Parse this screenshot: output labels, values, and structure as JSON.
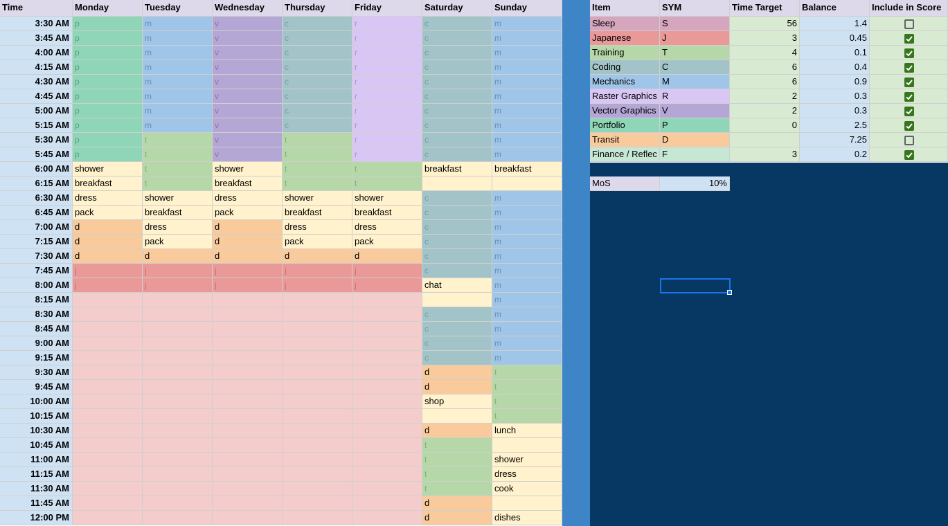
{
  "headers": [
    "Time",
    "Monday",
    "Tuesday",
    "Wednesday",
    "Thursday",
    "Friday",
    "Saturday",
    "Sunday"
  ],
  "colors": {
    "p": "#8fd6b8",
    "m": "#9fc5e8",
    "v": "#b4a7d6",
    "c": "#a2c4c9",
    "r": "#d9c6f5",
    "t": "#b6d7a8",
    "d": "#f9cb9c",
    "j": "#ea9999",
    "pink": "#f4cccc",
    "y": "#fff2cc",
    "time_col": "#cfe2f3",
    "header": "#ddd8ea"
  },
  "times": [
    "3:30 AM",
    "3:45 AM",
    "4:00 AM",
    "4:15 AM",
    "4:30 AM",
    "4:45 AM",
    "5:00 AM",
    "5:15 AM",
    "5:30 AM",
    "5:45 AM",
    "6:00 AM",
    "6:15 AM",
    "6:30 AM",
    "6:45 AM",
    "7:00 AM",
    "7:15 AM",
    "7:30 AM",
    "7:45 AM",
    "8:00 AM",
    "8:15 AM",
    "8:30 AM",
    "8:45 AM",
    "9:00 AM",
    "9:15 AM",
    "9:30 AM",
    "9:45 AM",
    "10:00 AM",
    "10:15 AM",
    "10:30 AM",
    "10:45 AM",
    "11:00 AM",
    "11:15 AM",
    "11:30 AM",
    "11:45 AM",
    "12:00 PM"
  ],
  "schedule": {
    "Monday": [
      "p",
      "p",
      "p",
      "p",
      "p",
      "p",
      "p",
      "p",
      "p",
      "p",
      "shower",
      "breakfast",
      "dress",
      "pack",
      "d",
      "d",
      "d",
      "j",
      "j",
      "",
      "",
      "",
      "",
      "",
      "",
      "",
      "",
      "",
      "",
      "",
      "",
      "",
      "",
      "",
      ""
    ],
    "Tuesday": [
      "m",
      "m",
      "m",
      "m",
      "m",
      "m",
      "m",
      "m",
      "t",
      "t",
      "t",
      "t",
      "shower",
      "breakfast",
      "dress",
      "pack",
      "d",
      "j",
      "j",
      "",
      "",
      "",
      "",
      "",
      "",
      "",
      "",
      "",
      "",
      "",
      "",
      "",
      "",
      "",
      ""
    ],
    "Wednesday": [
      "v",
      "v",
      "v",
      "v",
      "v",
      "v",
      "v",
      "v",
      "v",
      "v",
      "shower",
      "breakfast",
      "dress",
      "pack",
      "d",
      "d",
      "d",
      "j",
      "j",
      "",
      "",
      "",
      "",
      "",
      "",
      "",
      "",
      "",
      "",
      "",
      "",
      "",
      "",
      "",
      ""
    ],
    "Thursday": [
      "c",
      "c",
      "c",
      "c",
      "c",
      "c",
      "c",
      "c",
      "t",
      "t",
      "t",
      "t",
      "shower",
      "breakfast",
      "dress",
      "pack",
      "d",
      "j",
      "j",
      "",
      "",
      "",
      "",
      "",
      "",
      "",
      "",
      "",
      "",
      "",
      "",
      "",
      "",
      "",
      ""
    ],
    "Friday": [
      "r",
      "r",
      "r",
      "r",
      "r",
      "r",
      "r",
      "r",
      "r",
      "r",
      "t",
      "t",
      "shower",
      "breakfast",
      "dress",
      "pack",
      "d",
      "j",
      "j",
      "",
      "",
      "",
      "",
      "",
      "",
      "",
      "",
      "",
      "",
      "",
      "",
      "",
      "",
      "",
      ""
    ],
    "Saturday": [
      "c",
      "c",
      "c",
      "c",
      "c",
      "c",
      "c",
      "c",
      "c",
      "c",
      "breakfast",
      "",
      "c",
      "c",
      "c",
      "c",
      "c",
      "c",
      "chat",
      "",
      "c",
      "c",
      "c",
      "c",
      "d",
      "d",
      "shop",
      "",
      "d",
      "t",
      "t",
      "t",
      "t",
      "d",
      "d"
    ],
    "Sunday": [
      "m",
      "m",
      "m",
      "m",
      "m",
      "m",
      "m",
      "m",
      "m",
      "m",
      "breakfast",
      "",
      "m",
      "m",
      "m",
      "m",
      "m",
      "m",
      "m",
      "m",
      "m",
      "m",
      "m",
      "m",
      "t",
      "t",
      "t",
      "t",
      "lunch",
      "",
      "shower",
      "dress",
      "cook",
      "",
      "dishes"
    ]
  },
  "fills": {
    "Monday": [
      "p",
      "p",
      "p",
      "p",
      "p",
      "p",
      "p",
      "p",
      "p",
      "p",
      "y",
      "y",
      "y",
      "y",
      "d",
      "d",
      "d",
      "j",
      "j",
      "pink",
      "pink",
      "pink",
      "pink",
      "pink",
      "pink",
      "pink",
      "pink",
      "pink",
      "pink",
      "pink",
      "pink",
      "pink",
      "pink",
      "pink",
      "pink"
    ],
    "Tuesday": [
      "m",
      "m",
      "m",
      "m",
      "m",
      "m",
      "m",
      "m",
      "t",
      "t",
      "t",
      "t",
      "y",
      "y",
      "y",
      "y",
      "d",
      "j",
      "j",
      "pink",
      "pink",
      "pink",
      "pink",
      "pink",
      "pink",
      "pink",
      "pink",
      "pink",
      "pink",
      "pink",
      "pink",
      "pink",
      "pink",
      "pink",
      "pink"
    ],
    "Wednesday": [
      "v",
      "v",
      "v",
      "v",
      "v",
      "v",
      "v",
      "v",
      "v",
      "v",
      "y",
      "y",
      "y",
      "y",
      "d",
      "d",
      "d",
      "j",
      "j",
      "pink",
      "pink",
      "pink",
      "pink",
      "pink",
      "pink",
      "pink",
      "pink",
      "pink",
      "pink",
      "pink",
      "pink",
      "pink",
      "pink",
      "pink",
      "pink"
    ],
    "Thursday": [
      "c",
      "c",
      "c",
      "c",
      "c",
      "c",
      "c",
      "c",
      "t",
      "t",
      "t",
      "t",
      "y",
      "y",
      "y",
      "y",
      "d",
      "j",
      "j",
      "pink",
      "pink",
      "pink",
      "pink",
      "pink",
      "pink",
      "pink",
      "pink",
      "pink",
      "pink",
      "pink",
      "pink",
      "pink",
      "pink",
      "pink",
      "pink"
    ],
    "Friday": [
      "r",
      "r",
      "r",
      "r",
      "r",
      "r",
      "r",
      "r",
      "r",
      "r",
      "t",
      "t",
      "y",
      "y",
      "y",
      "y",
      "d",
      "j",
      "j",
      "pink",
      "pink",
      "pink",
      "pink",
      "pink",
      "pink",
      "pink",
      "pink",
      "pink",
      "pink",
      "pink",
      "pink",
      "pink",
      "pink",
      "pink",
      "pink"
    ],
    "Saturday": [
      "c",
      "c",
      "c",
      "c",
      "c",
      "c",
      "c",
      "c",
      "c",
      "c",
      "y",
      "y",
      "c",
      "c",
      "c",
      "c",
      "c",
      "c",
      "y",
      "y",
      "c",
      "c",
      "c",
      "c",
      "d",
      "d",
      "y",
      "y",
      "d",
      "t",
      "t",
      "t",
      "t",
      "d",
      "d"
    ],
    "Sunday": [
      "m",
      "m",
      "m",
      "m",
      "m",
      "m",
      "m",
      "m",
      "m",
      "m",
      "y",
      "y",
      "m",
      "m",
      "m",
      "m",
      "m",
      "m",
      "m",
      "m",
      "m",
      "m",
      "m",
      "m",
      "t",
      "t",
      "t",
      "t",
      "y",
      "y",
      "y",
      "y",
      "y",
      "y",
      "y"
    ]
  },
  "summary": {
    "headers": [
      "Item",
      "SYM",
      "Time Target",
      "Balance",
      "Include in Score"
    ],
    "rows": [
      {
        "item": "Sleep",
        "sym": "S",
        "target": "56",
        "balance": "1.4",
        "include": false,
        "color": "#d5a6bd"
      },
      {
        "item": "Japanese",
        "sym": "J",
        "target": "3",
        "balance": "0.45",
        "include": true,
        "color": "#ea9999"
      },
      {
        "item": "Training",
        "sym": "T",
        "target": "4",
        "balance": "0.1",
        "include": true,
        "color": "#b6d7a8"
      },
      {
        "item": "Coding",
        "sym": "C",
        "target": "6",
        "balance": "0.4",
        "include": true,
        "color": "#a2c4c9"
      },
      {
        "item": "Mechanics",
        "sym": "M",
        "target": "6",
        "balance": "0.9",
        "include": true,
        "color": "#9fc5e8"
      },
      {
        "item": "Raster Graphics",
        "sym": "R",
        "target": "2",
        "balance": "0.3",
        "include": true,
        "color": "#d9c6f5"
      },
      {
        "item": "Vector Graphics",
        "sym": "V",
        "target": "2",
        "balance": "0.3",
        "include": true,
        "color": "#b4a7d6"
      },
      {
        "item": "Portfolio",
        "sym": "P",
        "target": "0",
        "balance": "2.5",
        "include": true,
        "color": "#8fd6b8"
      },
      {
        "item": "Transit",
        "sym": "D",
        "target": "",
        "balance": "7.25",
        "include": false,
        "color": "#f9cb9c"
      },
      {
        "item": "Finance / Reflec",
        "sym": "F",
        "target": "3",
        "balance": "0.2",
        "include": true,
        "color": "#c6e7d3"
      }
    ],
    "target_color": "#d9ead3",
    "balance_color": "#cfe2f3"
  },
  "mos": {
    "label": "MoS",
    "value": "10%"
  }
}
